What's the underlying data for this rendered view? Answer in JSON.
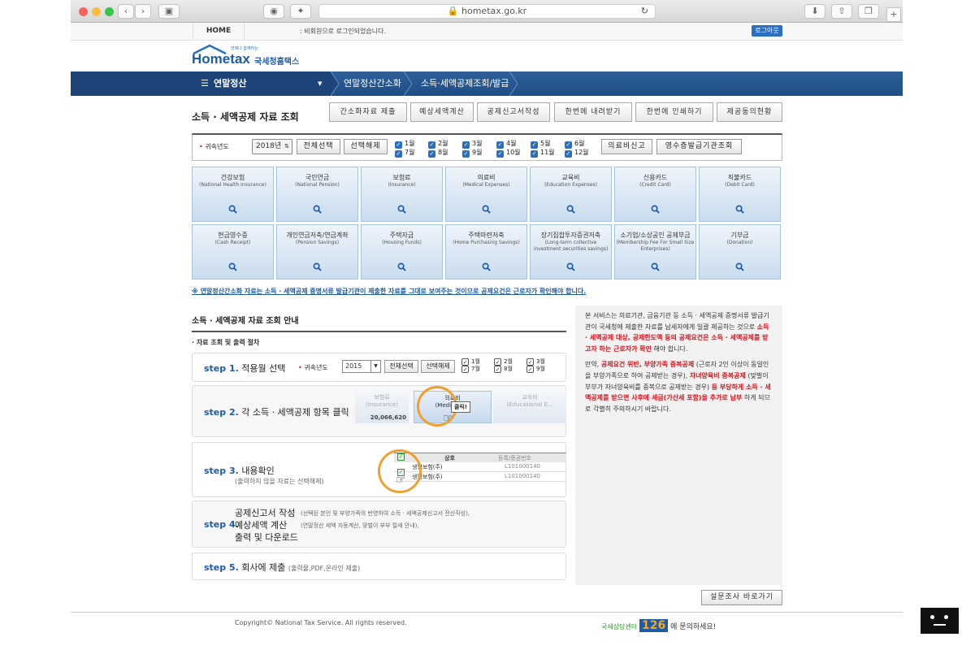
{
  "browser": {
    "url": "hometax.go.kr"
  },
  "topbar": {
    "home": "HOME",
    "notice": ": 비회원으로 로그인되었습니다.",
    "logout": "로그아웃"
  },
  "logo": {
    "brand": "Hometax",
    "slogan": "언제나 함께하는",
    "name": "국세청홈택스"
  },
  "nav": {
    "menu": "연말정산",
    "crumb1": "연말정산간소화",
    "crumb2": "소득·세액공제조회/발급"
  },
  "page_title": "소득 · 세액공제 자료 조회",
  "top_buttons": [
    "간소화자료 제출",
    "예상세액계산",
    "공제신고서작성",
    "한번에 내려받기",
    "한번에 인쇄하기",
    "제공동의현황"
  ],
  "filter": {
    "label": "귀속년도",
    "year": "2018년",
    "select_all": "전체선택",
    "deselect_all": "선택해제",
    "months": [
      "1월",
      "2월",
      "3월",
      "4월",
      "5월",
      "6월",
      "7월",
      "8월",
      "9월",
      "10월",
      "11월",
      "12월"
    ],
    "medical_report": "의료비신고",
    "receipt_lookup": "영수증발급기관조회"
  },
  "tiles": [
    {
      "ko": "건강보험",
      "en": "(National Health Insurance)"
    },
    {
      "ko": "국민연금",
      "en": "(National Pension)"
    },
    {
      "ko": "보험료",
      "en": "(Insurance)"
    },
    {
      "ko": "의료비",
      "en": "(Medical Expenses)"
    },
    {
      "ko": "교육비",
      "en": "(Education Expenses)"
    },
    {
      "ko": "신용카드",
      "en": "(Credit Card)"
    },
    {
      "ko": "직불카드",
      "en": "(Debit Card)"
    },
    {
      "ko": "현금영수증",
      "en": "(Cash Receipt)"
    },
    {
      "ko": "개인연금저축/연금계좌",
      "en": "(Pension Savings)"
    },
    {
      "ko": "주택자금",
      "en": "(Housing Funds)"
    },
    {
      "ko": "주택마련저축",
      "en": "(Home Purchasing Savings)"
    },
    {
      "ko": "장기집합투자증권저축",
      "en": "(Long-term collective investment securities savings)"
    },
    {
      "ko": "소기업/소상공인 공제부금",
      "en": "(Membership Fee For Small Size Enterprises)"
    },
    {
      "ko": "기부금",
      "en": "(Donation)"
    }
  ],
  "warning": "※ 연말정산간소화 자료는 소득 · 세액공제 증명서류 발급기관이 제출한 자료를 그대로 보여주는 것이므로 공제요건은 근로자가 확인해야 합니다.",
  "guide": {
    "title": "소득 · 세액공제 자료 조회 안내",
    "subtitle": "· 자료 조회 및 출력 절차",
    "step1": {
      "num": "step 1.",
      "text": "적용월 선택",
      "label": "귀속년도",
      "year": "2015",
      "all": "전체선택",
      "none": "선택해제",
      "m1": "1월",
      "m7": "7월",
      "m2": "2월",
      "m8": "8월",
      "m3": "3월",
      "m9": "9월"
    },
    "step2": {
      "num": "step 2.",
      "text": "각 소득 · 세액공제 항목 클릭",
      "t1": "보험료",
      "t1e": "(Insurance)",
      "t1v": "20,066,620",
      "t2": "의료비",
      "t2e": "(Medical E...",
      "click": "클릭!",
      "t3": "교육비",
      "t3e": "(Educational E..."
    },
    "step3": {
      "num": "step 3.",
      "text": "내용확인",
      "note": "(출력하지 않을 자료는 선택해제)",
      "col1": "상호",
      "col2": "등록/증권번호",
      "r1": "생명보험(주)",
      "r1n": "L101000140",
      "r2": "생명보험(주)",
      "r2n": "L101000140"
    },
    "step4": {
      "num": "step 4.",
      "line1": "공제신고서 작성",
      "line1n": "(선택된 본인 및 부양가족의 반영하여 소득 · 세액공제신고서 전산작성),",
      "line2": "예상세액 계산",
      "line2n": "(연말정산 세액 자동계산, 맞벌이 부부 절세 안내),",
      "line3": "출력 및 다운로드"
    },
    "step5": {
      "num": "step 5.",
      "text": "회사에 제출",
      "note": "(출력물,PDF,온라인 제출)"
    }
  },
  "info": {
    "p1a": "본 서비스는 의료기관, 금융기관 등 소득 · 세액공제 증명서류 발급기관이 국세청에 제출한 자료를 납세자에게 일괄 제공하는 것으로 ",
    "p1b": "소득 · 세액공제 대상, 공제한도액 등의 공제요건은 소득 · 세액공제를 받고자 하는 근로자가 확인",
    "p1c": " 해야 합니다.",
    "p2a": "만약, ",
    "p2b": "공제요건 위반, 부양가족 중복공제",
    "p2c": " (근로자 2인 이상이 동일인을 부양가족으로 하여 공제받는 경우), ",
    "p2d": "자녀양육비 중복공제",
    "p2e": " (맞벌이 부부가 자녀양육비를 중복으로 공제받는 경우) ",
    "p2f": "등 부당하게 소득 · 세액공제를 받으면 사후에 세금(가산세 포함)을 추가로 납부",
    "p2g": " 하게 되므로 각별히 주의하시기 바랍니다."
  },
  "survey": "설문조사 바로가기",
  "footer": {
    "copyright": "Copyright© National Tax Service. All rights reserved.",
    "center": "국세상담센터",
    "num": "126",
    "ask": "에 문의하세요!"
  }
}
